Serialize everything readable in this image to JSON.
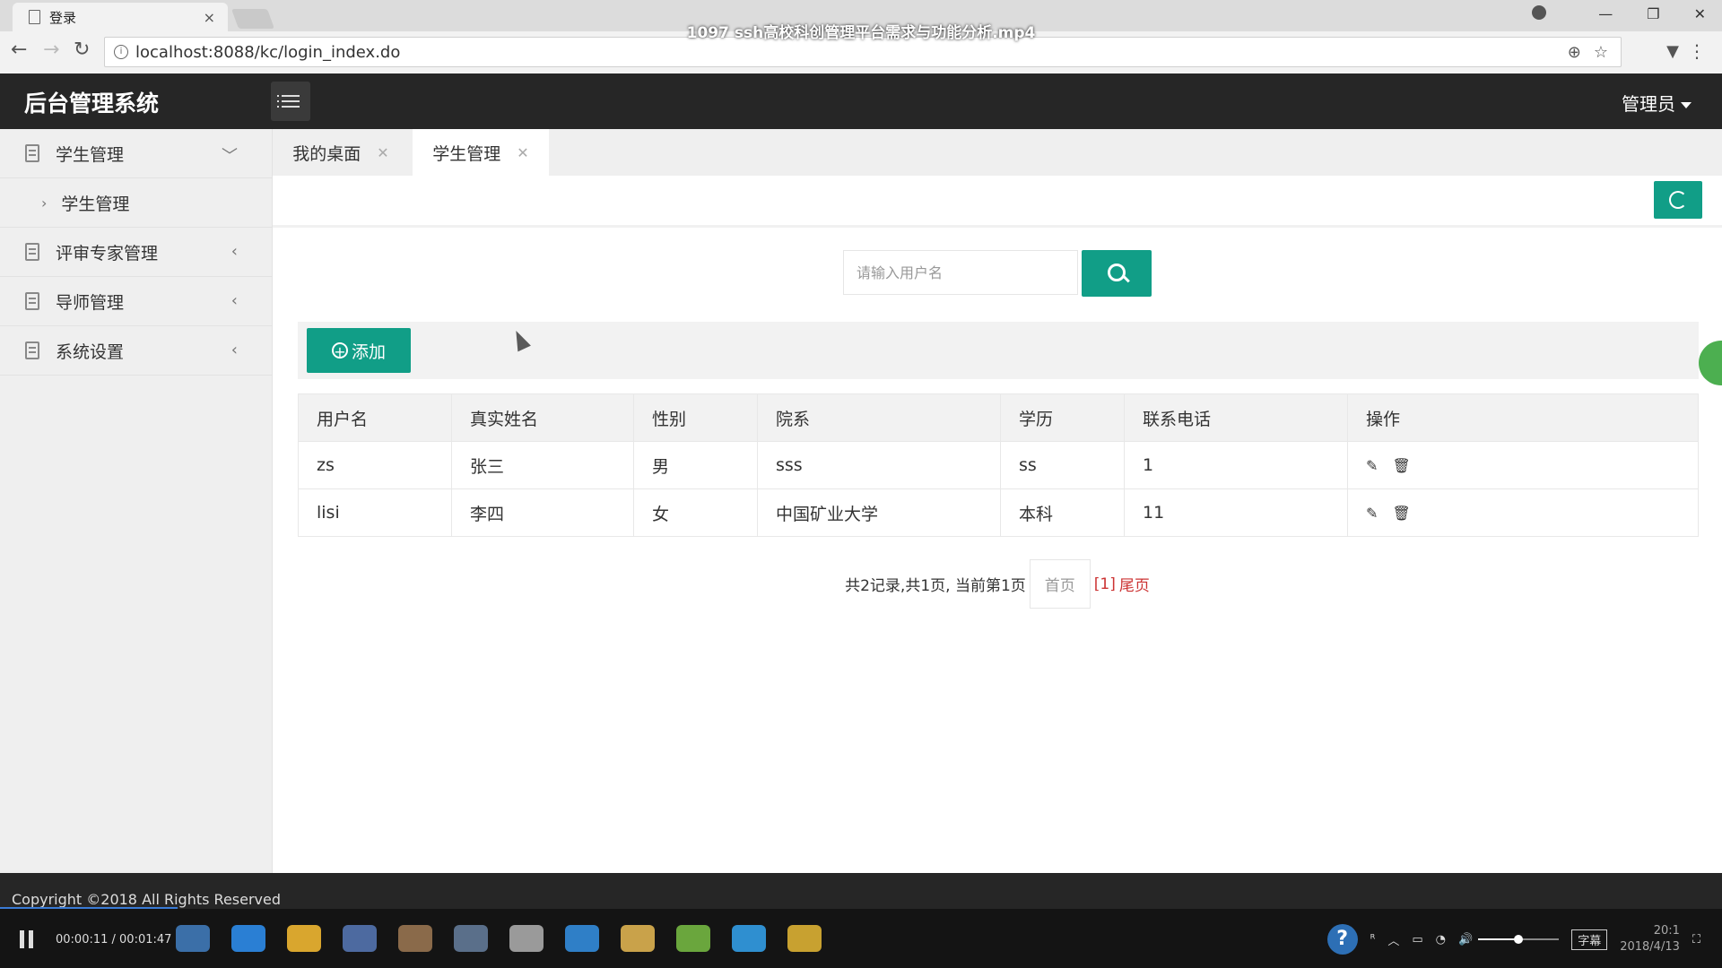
{
  "browser": {
    "tab_title": "登录",
    "tab_close": "×",
    "url": "localhost:8088/kc/login_index.do"
  },
  "video_title": "1097 ssh高校科创管理平台需求与功能分析.mp4",
  "app": {
    "title": "后台管理系统",
    "user_menu": "管理员"
  },
  "sidebar": {
    "items": [
      {
        "label": "学生管理",
        "expanded": true
      },
      {
        "label": "评审专家管理",
        "expanded": false
      },
      {
        "label": "导师管理",
        "expanded": false
      },
      {
        "label": "系统设置",
        "expanded": false
      }
    ],
    "sub_items": [
      {
        "label": "学生管理"
      }
    ]
  },
  "tabs": [
    {
      "label": "我的桌面",
      "active": false
    },
    {
      "label": "学生管理",
      "active": true
    }
  ],
  "search": {
    "placeholder": "请输入用户名",
    "value": ""
  },
  "actions": {
    "add_label": "添加"
  },
  "table": {
    "headers": [
      "用户名",
      "真实姓名",
      "性别",
      "院系",
      "学历",
      "联系电话",
      "操作"
    ],
    "rows": [
      [
        "zs",
        "张三",
        "男",
        "sss",
        "ss",
        "1"
      ],
      [
        "lisi",
        "李四",
        "女",
        "中国矿业大学",
        "本科",
        "11"
      ]
    ]
  },
  "pagination": {
    "summary": "共2记录,共1页, 当前第1页",
    "first": "首页",
    "current": "[1]",
    "last": "尾页"
  },
  "footer": {
    "copyright": "Copyright ©2018 All Rights Reserved"
  },
  "player": {
    "time": "00:00:11 / 00:01:47",
    "subtitle_label": "字幕",
    "clock_time": "20:1",
    "clock_date": "2018/4/13",
    "volume": 0.5
  },
  "colors": {
    "accent": "#119e87",
    "header_bg": "#262626",
    "sidebar_bg": "#efefef",
    "link_red": "#cc3333"
  }
}
